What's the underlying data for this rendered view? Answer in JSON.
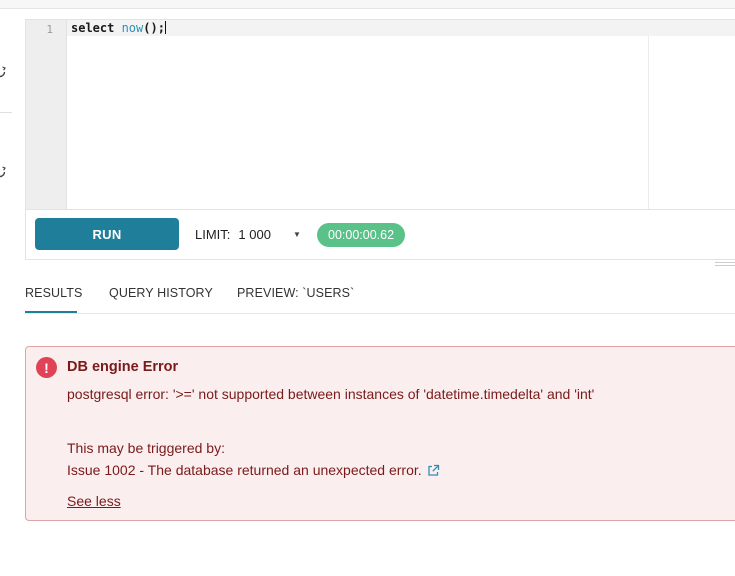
{
  "editor": {
    "line_number": "1",
    "code_keyword": "select ",
    "code_function": "now",
    "code_tail": "();"
  },
  "toolbar": {
    "run_label": "RUN",
    "limit_label": "LIMIT:",
    "limit_value": "1 000",
    "elapsed_time": "00:00:00.62"
  },
  "tabs": [
    {
      "label": "RESULTS",
      "active": true
    },
    {
      "label": "QUERY HISTORY",
      "active": false
    },
    {
      "label": "PREVIEW: `USERS`",
      "active": false
    }
  ],
  "error": {
    "icon_text": "!",
    "title": "DB engine Error",
    "message": "postgresql error: '>=' not supported between instances of 'datetime.timedelta' and 'int'",
    "trigger_label": "This may be triggered by:",
    "issue": "Issue 1002 - The database returned an unexpected error.",
    "toggle_label": "See less"
  },
  "colors": {
    "accent": "#1f7e99",
    "success_badge": "#5ac189",
    "error_background": "#fbeeee",
    "error_border": "#e0a3a3",
    "error_text": "#7a1a1a",
    "error_icon": "#e04355"
  },
  "icons": {
    "rail_top": "refresh-icon",
    "rail_bottom": "refresh-icon",
    "limit_caret": "caret-down-icon",
    "issue_link": "external-link-icon"
  }
}
